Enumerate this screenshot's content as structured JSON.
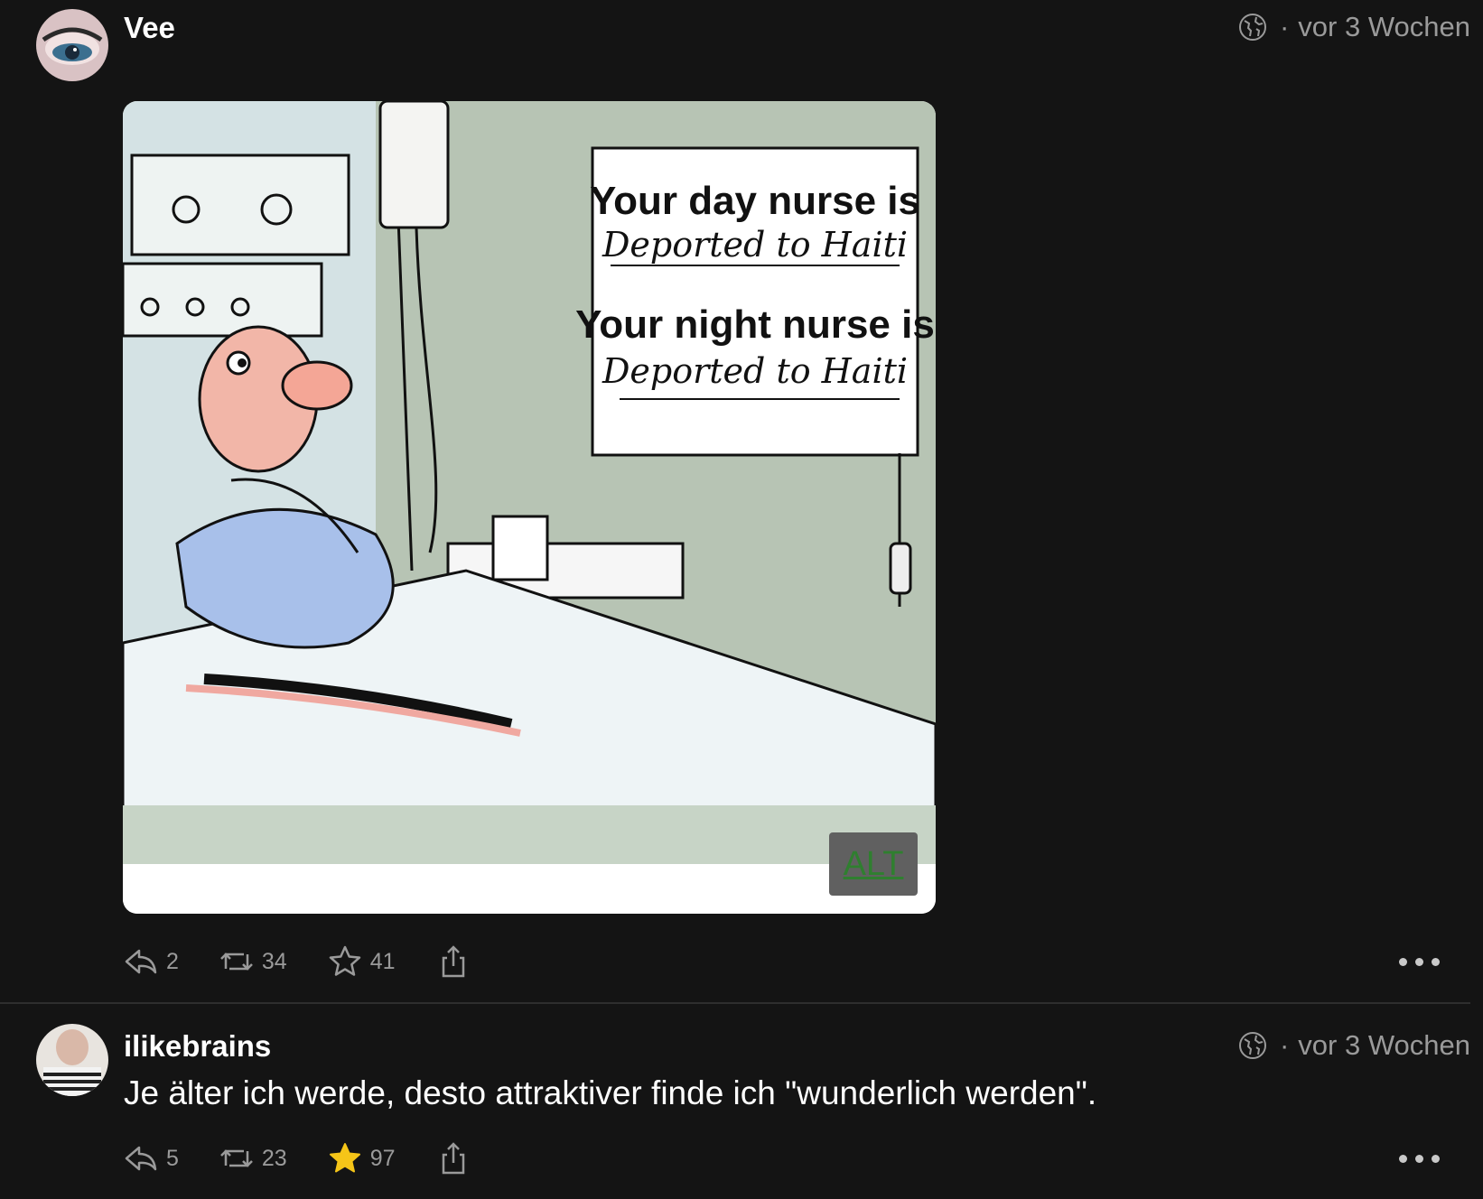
{
  "posts": [
    {
      "author": "Vee",
      "timestamp": "vor 3 Wochen",
      "visibility_icon": "globe-icon",
      "media": {
        "sign_line1": "Your day nurse is",
        "sign_line2": "Deported to Haiti",
        "sign_line3": "Your night nurse is",
        "sign_line4": "Deported to Haiti",
        "alt_label": "ALT"
      },
      "replies": "2",
      "boosts": "34",
      "favourites": "41",
      "favourited": false
    },
    {
      "author": "ilikebrains",
      "timestamp": "vor 3 Wochen",
      "visibility_icon": "globe-icon",
      "text": "Je älter ich werde, desto attraktiver finde ich \"wunderlich werden\".",
      "replies": "5",
      "boosts": "23",
      "favourites": "97",
      "favourited": true
    }
  ],
  "colors": {
    "background": "#141414",
    "muted_text": "#9a9a9a",
    "favourite_active": "#f5c518"
  }
}
